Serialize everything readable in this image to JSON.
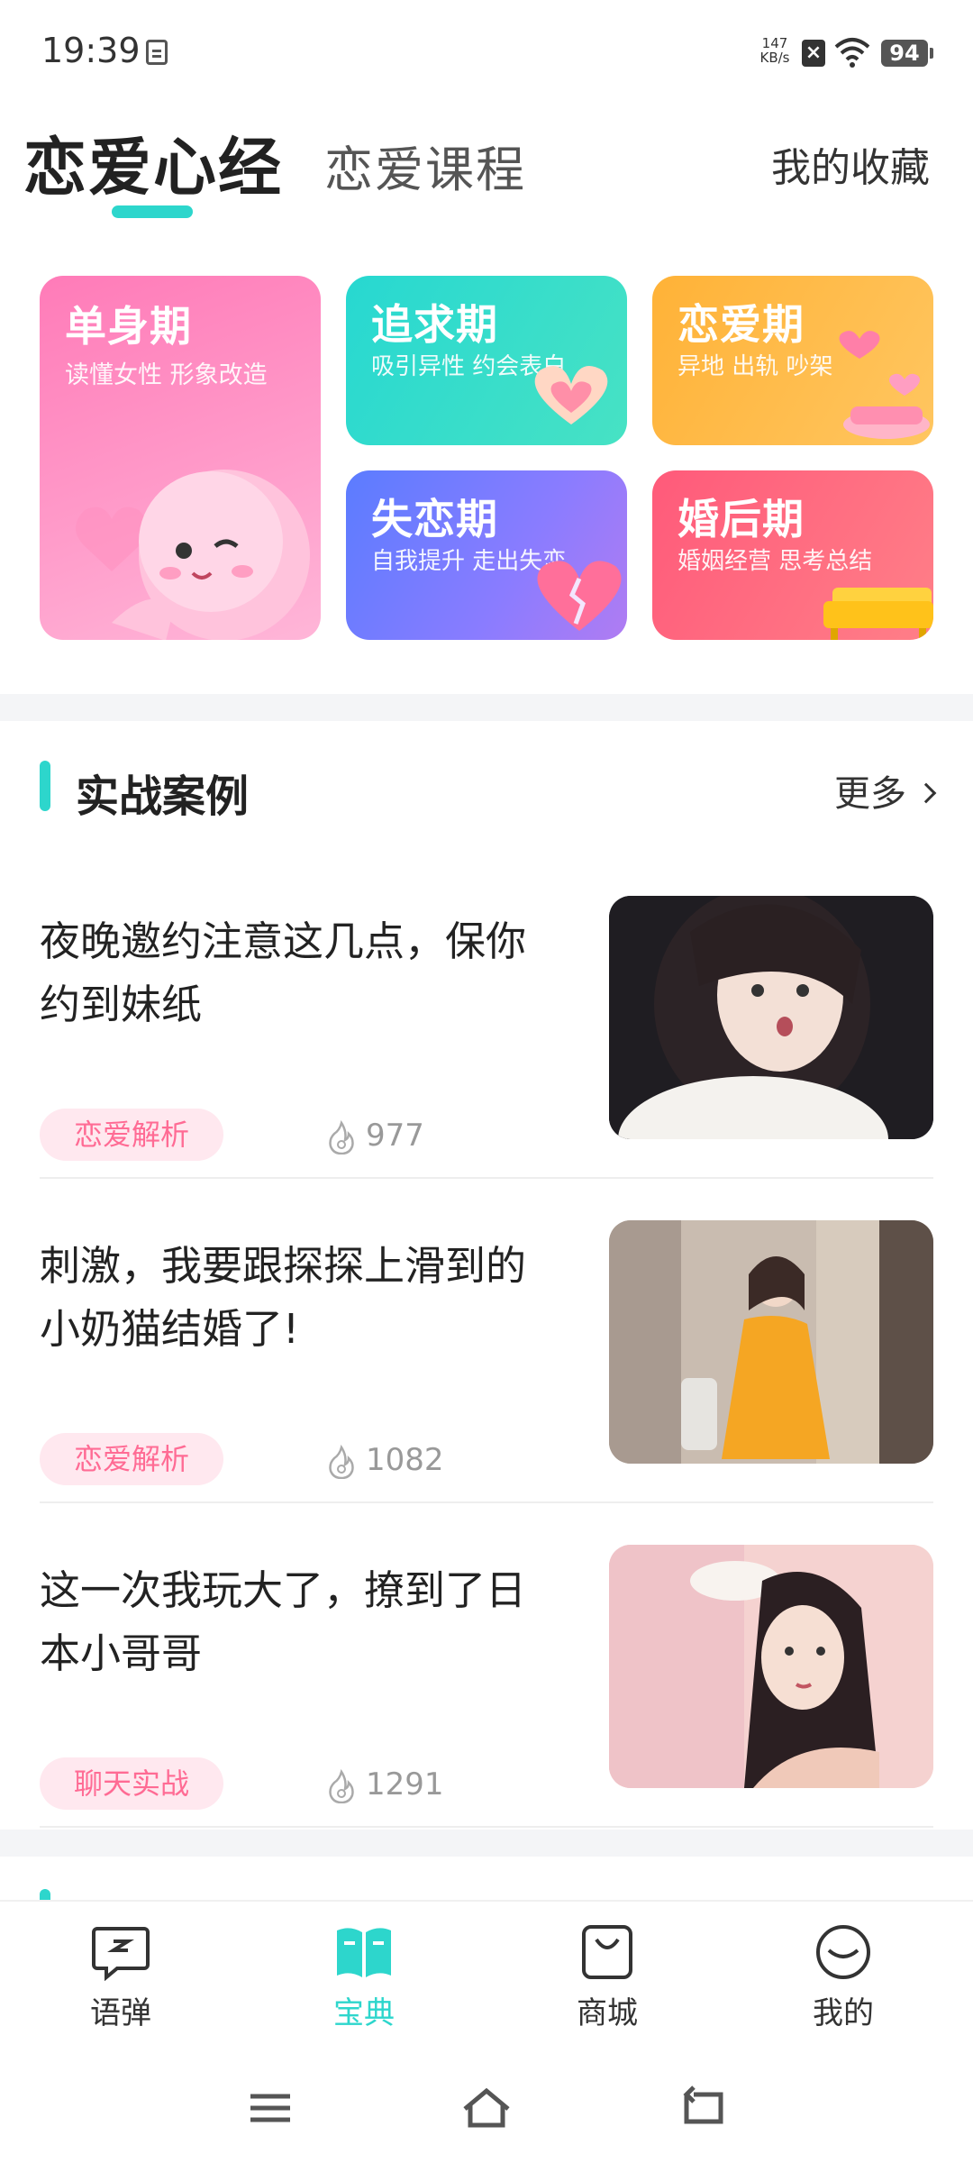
{
  "status_bar": {
    "time": "19:39",
    "net_speed": "147",
    "net_unit": "KB/s",
    "battery": "94"
  },
  "header": {
    "active_tab": "恋爱心经",
    "inactive_tab": "恋爱课程",
    "favorites": "我的收藏"
  },
  "stages": [
    {
      "title": "单身期",
      "subtitle": "读懂女性 形象改造"
    },
    {
      "title": "追求期",
      "subtitle": "吸引异性 约会表白"
    },
    {
      "title": "恋爱期",
      "subtitle": "异地 出轨 吵架"
    },
    {
      "title": "失恋期",
      "subtitle": "自我提升 走出失恋"
    },
    {
      "title": "婚后期",
      "subtitle": "婚姻经营 思考总结"
    }
  ],
  "section": {
    "title": "实战案例",
    "more": "更多"
  },
  "articles": [
    {
      "title": "夜晚邀约注意这几点，保你约到妹纸",
      "tag": "恋爱解析",
      "views": "977"
    },
    {
      "title": "刺激，我要跟探探上滑到的小奶猫结婚了!",
      "tag": "恋爱解析",
      "views": "1082"
    },
    {
      "title": "这一次我玩大了，撩到了日本小哥哥",
      "tag": "聊天实战",
      "views": "1291"
    }
  ],
  "bottom_nav": [
    {
      "label": "语弹",
      "icon": "chat-bubble-icon"
    },
    {
      "label": "宝典",
      "icon": "open-book-icon",
      "active": true
    },
    {
      "label": "商城",
      "icon": "shopping-bag-icon"
    },
    {
      "label": "我的",
      "icon": "smiley-face-icon"
    }
  ],
  "colors": {
    "accent": "#2dd6cc",
    "tag_bg": "#ffe8ef",
    "tag_text": "#ff6b94"
  }
}
